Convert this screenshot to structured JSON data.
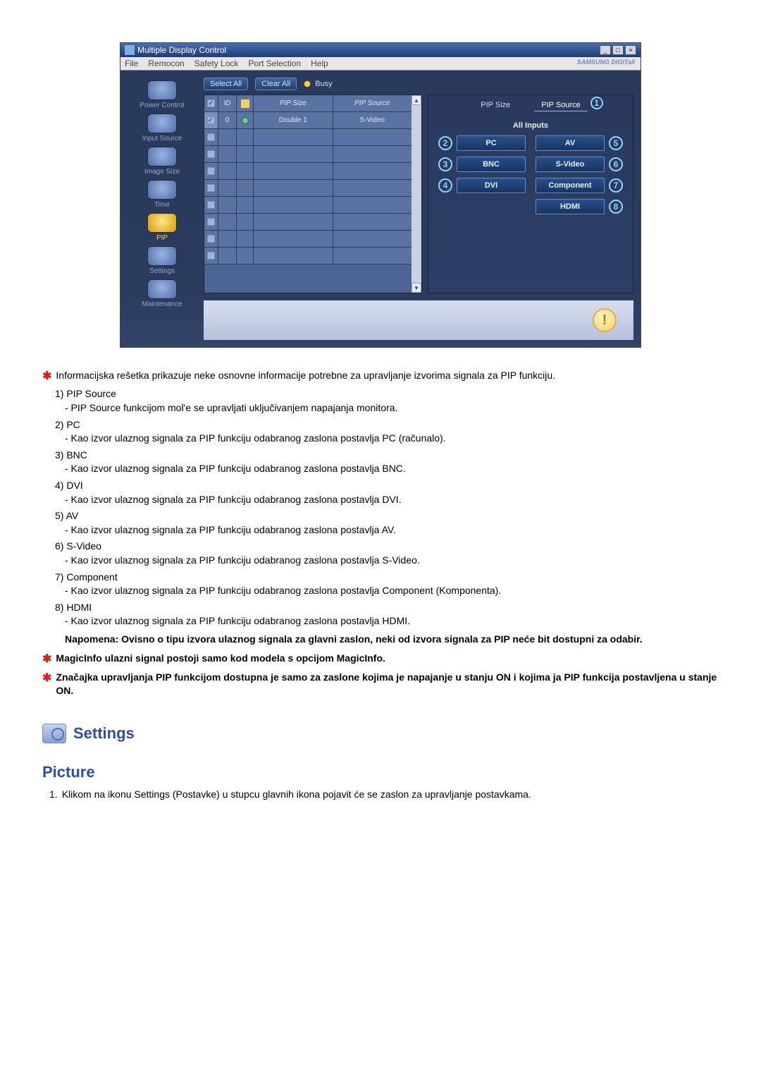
{
  "window": {
    "title": "Multiple Display Control",
    "menus": [
      "File",
      "Remocon",
      "Safety Lock",
      "Port Selection",
      "Help"
    ],
    "brand": "SAMSUNG DIGITall"
  },
  "sidebar": {
    "items": [
      {
        "label": "Power Control"
      },
      {
        "label": "Input Source"
      },
      {
        "label": "Image Size"
      },
      {
        "label": "Time"
      },
      {
        "label": "PIP"
      },
      {
        "label": "Settings"
      },
      {
        "label": "Maintenance"
      }
    ]
  },
  "toolbar": {
    "select_all": "Select All",
    "clear_all": "Clear All",
    "busy_label": "Busy"
  },
  "grid": {
    "headers": {
      "id": "ID",
      "pip_size": "PIP Size",
      "pip_source": "PIP Source"
    },
    "rows": [
      {
        "id": "0",
        "pip_size": "Double 1",
        "pip_source": "S-Video",
        "checked": true
      }
    ]
  },
  "right": {
    "tabs": {
      "pip_size": "PIP Size",
      "pip_source": "PIP Source"
    },
    "section_title": "All Inputs",
    "buttons": {
      "pc": "PC",
      "av": "AV",
      "bnc": "BNC",
      "svideo": "S-Video",
      "dvi": "DVI",
      "component": "Component",
      "hdmi": "HDMI"
    },
    "callouts": {
      "main": "1",
      "pc": "2",
      "bnc": "3",
      "dvi": "4",
      "av": "5",
      "svideo": "6",
      "component": "7",
      "hdmi": "8"
    }
  },
  "explain": {
    "intro": "Informacijska rešetka prikazuje neke osnovne informacije potrebne za upravljanje izvorima signala za PIP funkciju.",
    "items": [
      {
        "n": "1)",
        "title": "PIP Source",
        "desc": "- PIP Source funkcijom mol'e se upravljati uključivanjem napajanja monitora."
      },
      {
        "n": "2)",
        "title": "PC",
        "desc": "- Kao izvor ulaznog signala za PIP funkciju odabranog zaslona postavlja PC (računalo)."
      },
      {
        "n": "3)",
        "title": "BNC",
        "desc": "- Kao izvor ulaznog signala za PIP funkciju odabranog zaslona postavlja BNC."
      },
      {
        "n": "4)",
        "title": "DVI",
        "desc": "- Kao izvor ulaznog signala za PIP funkciju odabranog zaslona postavlja DVI."
      },
      {
        "n": "5)",
        "title": "AV",
        "desc": "- Kao izvor ulaznog signala za PIP funkciju odabranog zaslona postavlja AV."
      },
      {
        "n": "6)",
        "title": "S-Video",
        "desc": "- Kao izvor ulaznog signala za PIP funkciju odabranog zaslona postavlja S-Video."
      },
      {
        "n": "7)",
        "title": "Component",
        "desc": "- Kao izvor ulaznog signala za PIP funkciju odabranog zaslona postavlja Component (Komponenta)."
      },
      {
        "n": "8)",
        "title": "HDMI",
        "desc": "- Kao izvor ulaznog signala za PIP funkciju odabranog zaslona postavlja HDMI."
      }
    ],
    "note_bold": "Napomena: Ovisno o tipu izvora ulaznog signala za glavni zaslon, neki od izvora signala za PIP neće bit dostupni za odabir.",
    "extra1": "MagicInfo ulazni signal postoji samo kod modela s opcijom MagicInfo.",
    "extra2": "Značajka upravljanja PIP funkcijom dostupna je samo za zaslone kojima je napajanje u stanju ON i kojima ja PIP funkcija postavljena u stanje ON."
  },
  "settings": {
    "heading": "Settings"
  },
  "picture": {
    "heading": "Picture",
    "item1_n": "1.",
    "item1": "Klikom na ikonu Settings (Postavke) u stupcu glavnih ikona pojavit će se zaslon za upravljanje postavkama."
  }
}
